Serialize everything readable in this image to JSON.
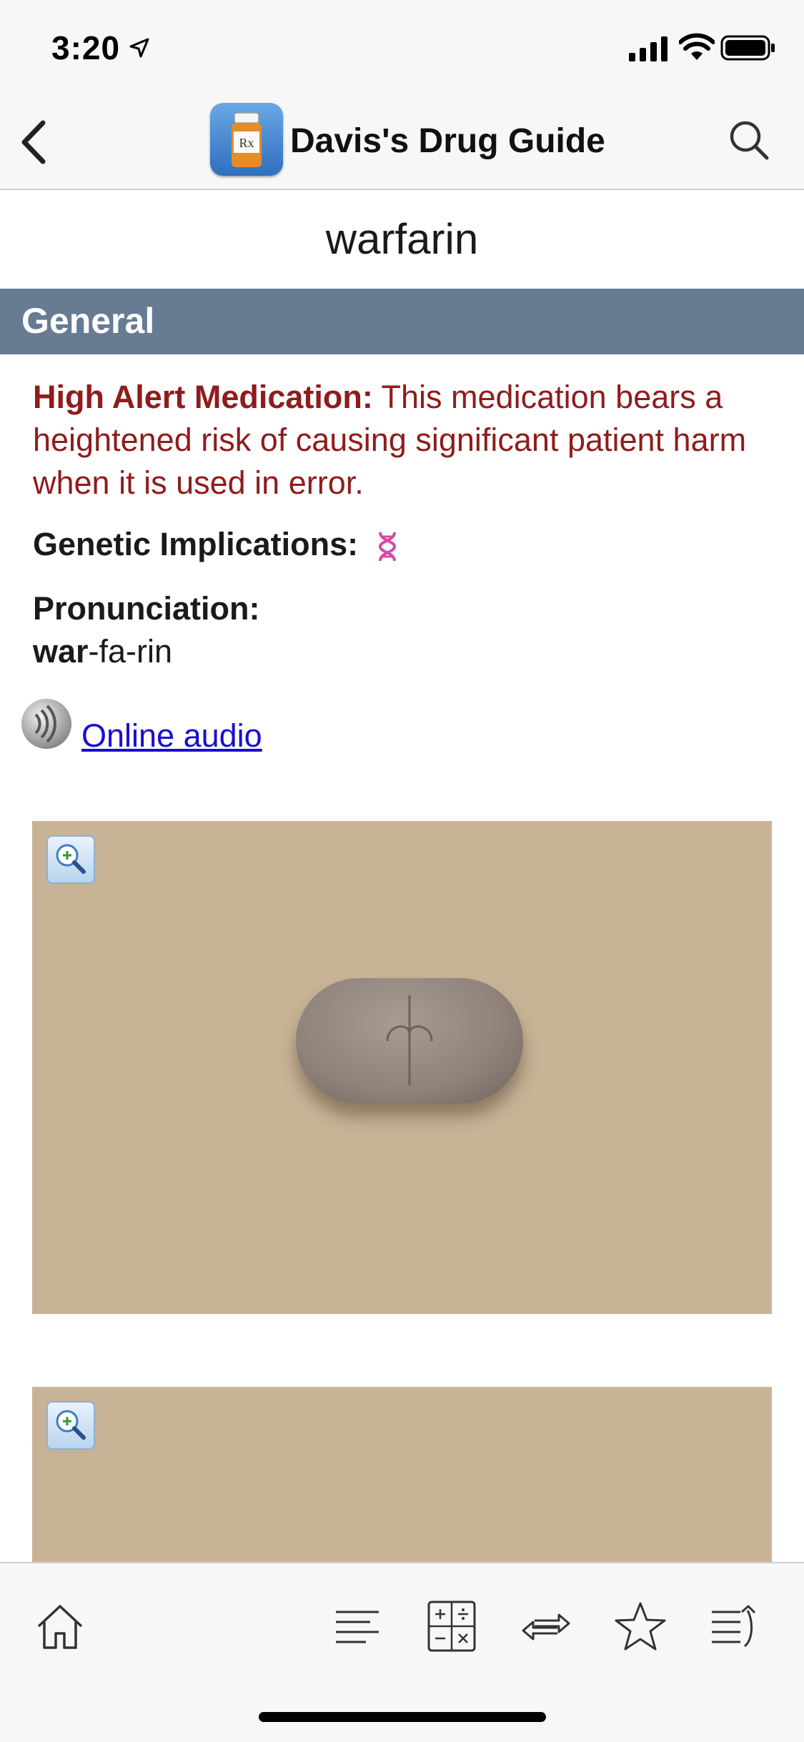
{
  "status_bar": {
    "time": "3:20"
  },
  "nav": {
    "title": "Davis's Drug Guide",
    "app_icon_label": "Rx"
  },
  "drug": {
    "name": "warfarin"
  },
  "section": {
    "title": "General"
  },
  "high_alert": {
    "label": "High Alert Medication:",
    "text": " This medication bears a heightened risk of causing significant patient harm when it is used in error."
  },
  "genetic": {
    "label": "Genetic Implications:"
  },
  "pronunciation": {
    "label": "Pronunciation:",
    "stressed": "war",
    "rest": "-fa-rin"
  },
  "audio": {
    "link_text": "Online audio"
  },
  "toolbar": {
    "icons": [
      "home-icon",
      "list-icon",
      "calculator-icon",
      "swap-icon",
      "star-icon",
      "history-icon"
    ]
  }
}
